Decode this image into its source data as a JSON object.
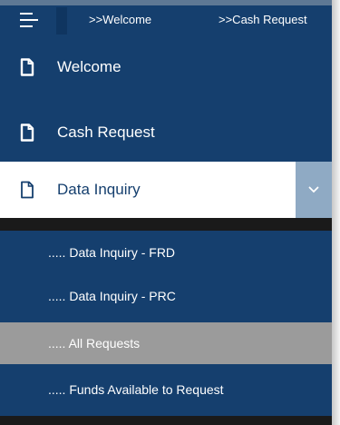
{
  "breadcrumbs": [
    ">>Welcome",
    ">>Cash Request"
  ],
  "menu": {
    "items": [
      {
        "label": "Welcome",
        "icon": "document-icon",
        "active": false
      },
      {
        "label": "Cash Request",
        "icon": "document-icon",
        "active": false
      },
      {
        "label": "Data Inquiry",
        "icon": "document-icon",
        "active": true,
        "expanded": true
      }
    ],
    "submenu": [
      {
        "label": "..... Data Inquiry - FRD",
        "selected": false
      },
      {
        "label": "..... Data Inquiry - PRC",
        "selected": false
      },
      {
        "label": "..... All Requests",
        "selected": true
      },
      {
        "label": "..... Funds Available to Request",
        "selected": false
      }
    ]
  },
  "icons": {
    "menu_toggle": "hamburger-icon",
    "expand": "chevron-down-icon"
  },
  "colors": {
    "panel_background": "#153f6e",
    "active_background": "#ffffff",
    "chevron_box": "#8faac4",
    "selected_submenu": "#9b9b9b"
  }
}
